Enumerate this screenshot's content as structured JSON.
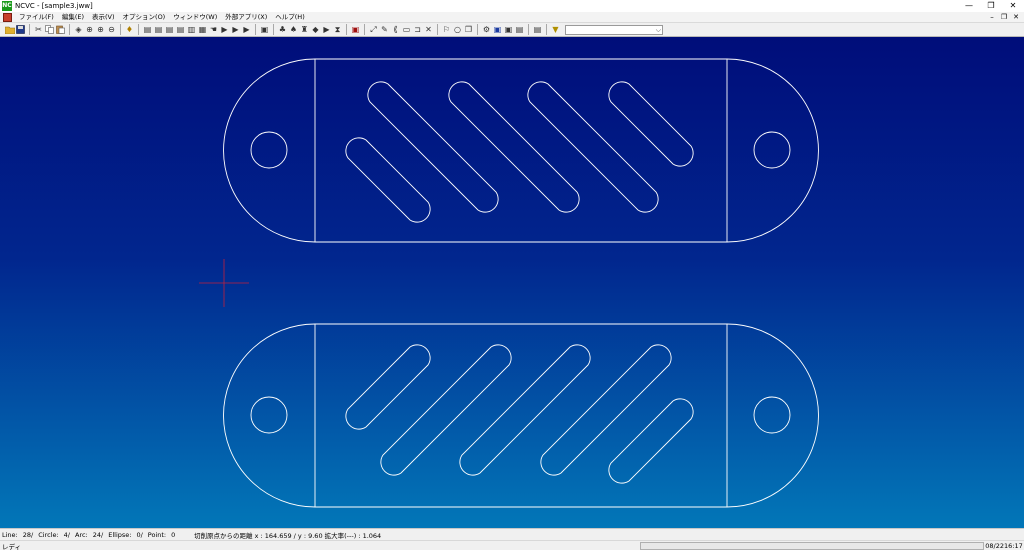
{
  "window": {
    "app_icon_text": "NC",
    "title": "NCVC - [sample3.jww]",
    "minimize": "—",
    "maximize": "❐",
    "close": "✕"
  },
  "menu": {
    "items": [
      "ファイル(F)",
      "編集(E)",
      "表示(V)",
      "オプション(O)",
      "ウィンドウ(W)",
      "外部アプリ(X)",
      "ヘルプ(H)"
    ],
    "mdi_minimize": "–",
    "mdi_restore": "❐",
    "mdi_close": "✕"
  },
  "toolbar": {
    "combo_value": "",
    "combo_arrow": "⌵"
  },
  "status": {
    "line": "Line:",
    "line_count": "28/",
    "circle": "Circle:",
    "circle_count": "4/",
    "arc": "Arc:",
    "arc_count": "24/",
    "ellipse": "Ellipse:",
    "ellipse_count": "0/",
    "point": "Point:",
    "point_count": "0",
    "info": "切削原点からの距離  x : 164.659 / y : 9.60  拡大率(---) : 1.064"
  },
  "statusbar": {
    "ready": "レディ",
    "date": "08/22",
    "time": "16:17"
  },
  "colors": {
    "canvas_top": "#000d7a",
    "canvas_bottom": "#0277b8",
    "geometry": "#ffffff",
    "cursor": "#c0203c"
  }
}
